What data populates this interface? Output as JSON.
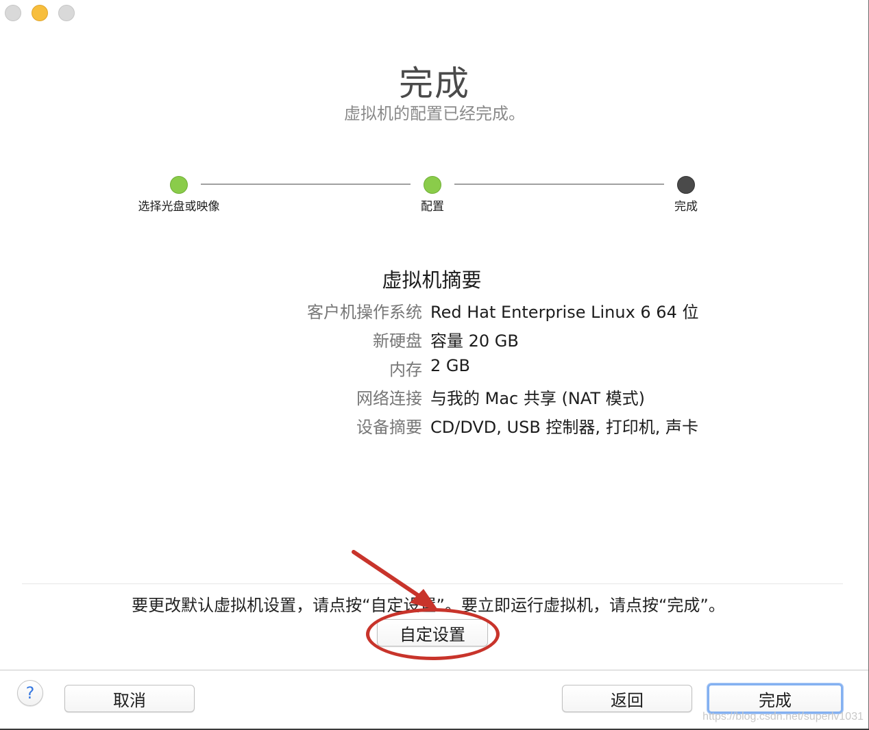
{
  "header": {
    "title": "完成",
    "subtitle": "虚拟机的配置已经完成。"
  },
  "steps": [
    {
      "label": "选择光盘或映像",
      "status": "done"
    },
    {
      "label": "配置",
      "status": "done"
    },
    {
      "label": "完成",
      "status": "current"
    }
  ],
  "summary": {
    "title": "虚拟机摘要",
    "rows": [
      {
        "key": "客户机操作系统",
        "value": "Red Hat Enterprise Linux 6 64 位"
      },
      {
        "key": "新硬盘",
        "value": "容量 20 GB"
      },
      {
        "key": "内存",
        "value": "2 GB"
      },
      {
        "key": "网络连接",
        "value": "与我的 Mac 共享 (NAT 模式)"
      },
      {
        "key": "设备摘要",
        "value": "CD/DVD, USB 控制器, 打印机, 声卡"
      }
    ]
  },
  "instruction": "要更改默认虚拟机设置，请点按“自定设置”。要立即运行虚拟机，请点按“完成”。",
  "buttons": {
    "customize": "自定设置",
    "cancel": "取消",
    "back": "返回",
    "done": "完成",
    "help": "?"
  },
  "watermark": "https://blog.csdn.net/superlv1031",
  "colors": {
    "step_done": "#8acc4a",
    "step_current": "#4a4a4a",
    "annotation": "#c8342b",
    "default_button_ring": "#84b1f1"
  }
}
